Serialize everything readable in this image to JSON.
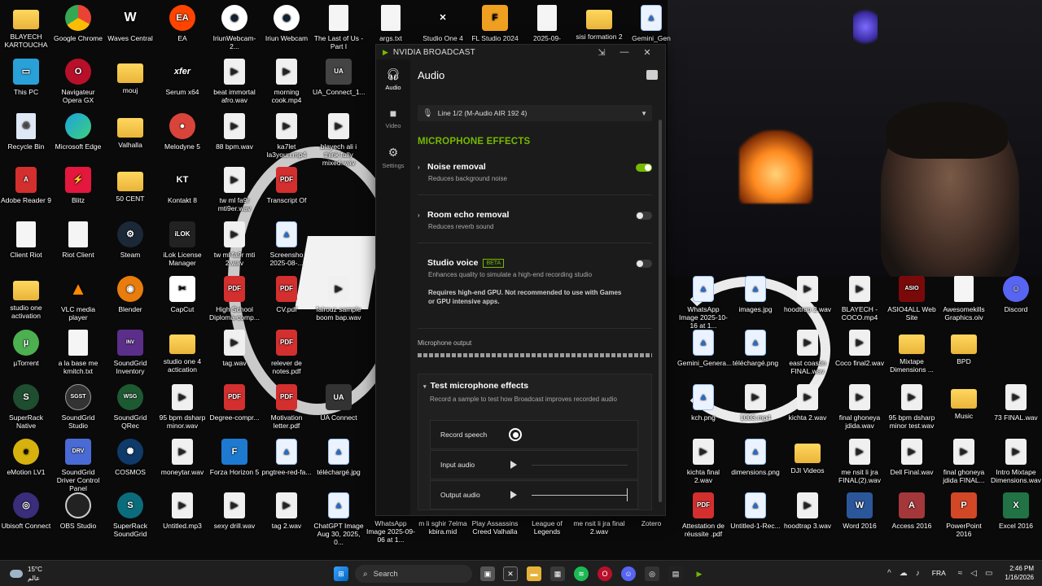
{
  "desktop": {
    "col1": [
      "BLAYECH KARTOUCHA",
      "This PC",
      "Recycle Bin",
      "Adobe Reader 9",
      "Client Riot",
      "studio one activation",
      "µTorrent",
      "SuperRack Native",
      "eMotion LV1",
      "Ubisoft Connect"
    ],
    "col2": [
      "Google Chrome",
      "Navigateur Opera GX",
      "Microsoft Edge",
      "Blitz",
      "Riot Client",
      "VLC media player",
      "a la base me kmitch.txt",
      "SoundGrid Studio",
      "SoundGrid Driver Control Panel",
      "OBS Studio"
    ],
    "col3": [
      "Waves Central",
      "mouj",
      "Valhalla",
      "50 CENT",
      "Steam",
      "Blender",
      "SoundGrid Inventory",
      "SoundGrid QRec",
      "COSMOS",
      "SuperRack SoundGrid"
    ],
    "col4": [
      "EA",
      "Serum x64",
      "Melodyne 5",
      "Kontakt 8",
      "iLok License Manager",
      "CapCut",
      "studio one 4 actication",
      "95 bpm dsharp minor.wav",
      "moneytar.wav",
      "Untitled.mp3"
    ],
    "col5": [
      "IriunWebcam-2...",
      "beat immortal afro.wav",
      "88 bpm.wav",
      "tw ml fa9r mti9er.wav",
      "tw ml fa9r mti 2.wav",
      "High School Diploma-comp...",
      "tag.wav",
      "Degree-compr...",
      "Forza Horizon 5",
      "sexy drill.wav"
    ],
    "col6": [
      "Iriun Webcam",
      "morning cook.mp4",
      "ka7let la3youn.mp4",
      "Transcript Of",
      "Screensho 2025-08-...",
      "CV.pdf",
      "relever de notes.pdf",
      "Motivation letter.pdf",
      "pngtree-red-fa...",
      "tag 2.wav"
    ],
    "col7": [
      "The Last of Us - Part I",
      "UA_Connect_1...",
      "blayech ali i think fully mixed.wav",
      "fairouz sample boom bap.wav",
      "UA Connect",
      "téléchargé.jpg",
      "ChatGPT Image Aug 30, 2025, 0..."
    ],
    "top_row_extra": [
      "args.txt",
      "Studio One 4",
      "FL Studio 2024",
      "2025-09-20_00...",
      "sisi formation 2",
      "Gemini_Gen"
    ],
    "bottom_row_extra": [
      "WhatsApp Image 2025-09-06 at 1...",
      "m li sghir 7elma kbira.mid",
      "Play Assassins Creed Valhalla",
      "League of Legends",
      "me nsit li jra final 2.wav",
      "Zotero"
    ],
    "right_rows": [
      [
        "WhatsApp Image 2025-10-16 at 1...",
        "images.jpg",
        "hoodtrap 2.wav",
        "BLAYECH - COCO.mp4",
        "ASIO4ALL Web Site",
        "Awesomekills Graphics.oiv",
        "Discord"
      ],
      [
        "Gemini_Genera...",
        "téléchargé.png",
        "east coastin FINAL.wav",
        "Coco final2.wav",
        "Mixtape Dimensions ...",
        "BPD"
      ],
      [
        "kch.png",
        "1003.mp4",
        "kichta 2.wav",
        "final ghoneya jdida.wav",
        "95 bpm dsharp minor test.wav",
        "Music",
        "73 FINAL.wav"
      ],
      [
        "kichta final 2.wav",
        "dimensions.png",
        "DJI Videos",
        "me nsit li jra FINAL(2).wav",
        "Dell Final.wav",
        "final ghoneya jdida FINAL...",
        "Intro Mixtape Dimensions.wav"
      ],
      [
        "Attestation de réussite .pdf",
        "Untitled-1-Rec...",
        "hoodtrap 3.wav",
        "Word 2016",
        "Access 2016",
        "PowerPoint 2016",
        "Excel 2016"
      ]
    ]
  },
  "broadcast": {
    "title": "NVIDIA BROADCAST",
    "sidebar": [
      {
        "label": "Audio",
        "icon": "headphones-icon"
      },
      {
        "label": "Video",
        "icon": "camera-icon"
      },
      {
        "label": "Settings",
        "icon": "gear-icon"
      }
    ],
    "header": "Audio",
    "device": "Line 1/2 (M-Audio AIR 192 4)",
    "section_title": "MICROPHONE EFFECTS",
    "effects": [
      {
        "name": "Noise removal",
        "desc": "Reduces background noise",
        "on": true
      },
      {
        "name": "Room echo removal",
        "desc": "Reduces reverb sound",
        "on": false
      },
      {
        "name": "Studio voice",
        "badge": "BETA",
        "desc": "Enhances quality to simulate a high-end recording studio",
        "warning": "Requires high-end GPU. Not recommended to use with Games or GPU intensive apps.",
        "on": false
      }
    ],
    "mic_output_label": "Microphone output",
    "test": {
      "title": "Test microphone effects",
      "desc": "Record a sample to test how Broadcast improves recorded audio",
      "record_label": "Record speech",
      "input_label": "Input audio",
      "output_label": "Output audio"
    }
  },
  "taskbar": {
    "weather_temp": "15°C",
    "weather_text": "عالم",
    "search_placeholder": "Search",
    "lang": "FRA",
    "time": "2:46 PM",
    "date": "1/16/2026"
  },
  "colors": {
    "accent": "#76b900",
    "window_bg": "#1b1b1b"
  }
}
